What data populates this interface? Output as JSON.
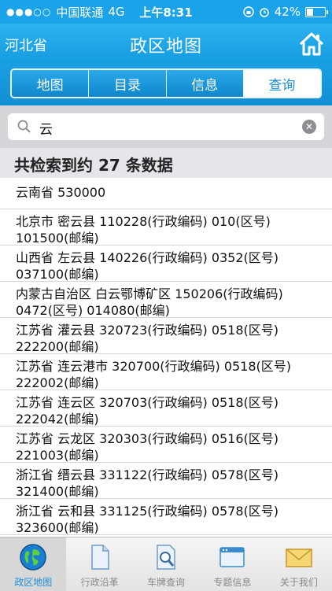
{
  "status_bar": {
    "carrier": "中国联通",
    "network": "4G",
    "time": "上午8:31",
    "battery": "42%",
    "battery_level": 0.42
  },
  "header": {
    "province": "河北省",
    "title": "政区地图"
  },
  "tabs": [
    {
      "label": "地图",
      "active": false
    },
    {
      "label": "目录",
      "active": false
    },
    {
      "label": "信息",
      "active": false
    },
    {
      "label": "查询",
      "active": true
    }
  ],
  "search": {
    "value": "云",
    "placeholder": ""
  },
  "results": {
    "summary": "共检索到约 27 条数据",
    "items": [
      {
        "line1": "云南省 530000",
        "line2": ""
      },
      {
        "line1": "北京市 密云县 110228(行政编码) 010(区号)",
        "line2": "101500(邮编)"
      },
      {
        "line1": "山西省 左云县 140226(行政编码) 0352(区号)",
        "line2": "037100(邮编)"
      },
      {
        "line1": "内蒙古自治区 白云鄂博矿区 150206(行政编码)",
        "line2": "0472(区号) 014080(邮编)"
      },
      {
        "line1": "江苏省 灌云县 320723(行政编码) 0518(区号)",
        "line2": "222200(邮编)"
      },
      {
        "line1": "江苏省 连云港市 320700(行政编码) 0518(区号)",
        "line2": "222002(邮编)"
      },
      {
        "line1": "江苏省 连云区 320703(行政编码) 0518(区号)",
        "line2": "222042(邮编)"
      },
      {
        "line1": "江苏省 云龙区 320303(行政编码) 0516(区号)",
        "line2": "221003(邮编)"
      },
      {
        "line1": "浙江省 缙云县 331122(行政编码) 0578(区号)",
        "line2": "321400(邮编)"
      },
      {
        "line1": "浙江省 云和县 331125(行政编码) 0578(区号)",
        "line2": "323600(邮编)"
      }
    ]
  },
  "tabbar": [
    {
      "label": "政区地图",
      "icon": "globe-icon",
      "active": true
    },
    {
      "label": "行政沿革",
      "icon": "document-icon",
      "active": false
    },
    {
      "label": "车牌查询",
      "icon": "magnifier-document-icon",
      "active": false
    },
    {
      "label": "专题信息",
      "icon": "window-icon",
      "active": false
    },
    {
      "label": "关于我们",
      "icon": "envelope-icon",
      "active": false
    }
  ],
  "colors": {
    "accent": "#1a9fe2",
    "tab_active_text": "#1a8fd8"
  }
}
